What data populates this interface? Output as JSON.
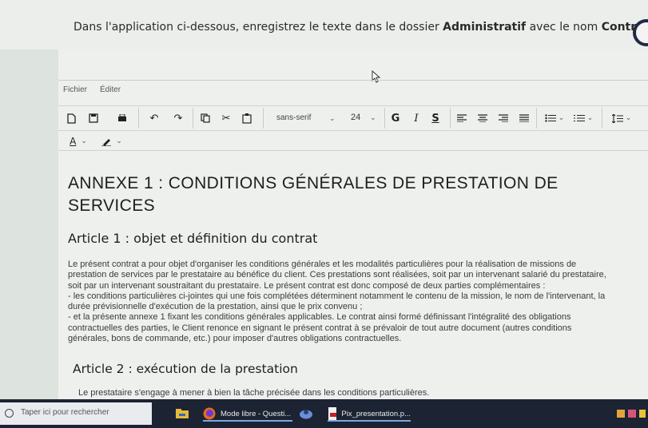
{
  "instruction": {
    "prefix": "Dans l'application ci-dessous, enregistrez le texte dans le dossier ",
    "folder": "Administratif",
    "middle": " avec le nom ",
    "filename": "Contrat",
    "suffix": "."
  },
  "menu": {
    "file": "Fichier",
    "edit": "Éditer"
  },
  "toolbar": {
    "font_family": "sans-serif",
    "font_size": "24",
    "bold": "G",
    "italic": "I",
    "underline": "S",
    "text_color": "A"
  },
  "document": {
    "title": "ANNEXE 1 : CONDITIONS GÉNÉRALES DE PRESTATION DE SERVICES",
    "article1_heading": "Article 1 : objet et définition du contrat",
    "article1_lines": [
      "Le présent contrat a pour objet d'organiser les conditions générales et les modalités particulières pour la réalisation de missions de",
      "prestation de services par le prestataire au bénéfice du client. Ces prestations sont réalisées, soit par un intervenant salarié du prestataire,",
      "soit par un intervenant soustraitant du prestataire. Le présent contrat est donc composé de deux parties complémentaires :",
      "- les conditions particulières ci-jointes qui une fois complétées déterminent notamment le contenu de la mission, le nom de l'intervenant, la",
      "durée prévisionnelle d'exécution de la prestation, ainsi que le prix convenu ;",
      "- et la présente annexe 1 fixant les conditions générales applicables. Le contrat ainsi formé définissant l'intégralité des obligations",
      "contractuelles des parties, le Client renonce en signant le présent contrat à se prévaloir de tout autre document (autres conditions",
      "générales, bons de commande, etc.) pour imposer d'autres obligations contractuelles."
    ],
    "article2_heading": "Article 2 : exécution de la prestation",
    "article2_text": "Le prestataire s'engage à mener à bien la tâche précisée dans les conditions particulières."
  },
  "taskbar": {
    "search_placeholder": "Taper ici pour rechercher",
    "app1": "Mode libre - Questi...",
    "app2": "Pix_presentation.p..."
  }
}
